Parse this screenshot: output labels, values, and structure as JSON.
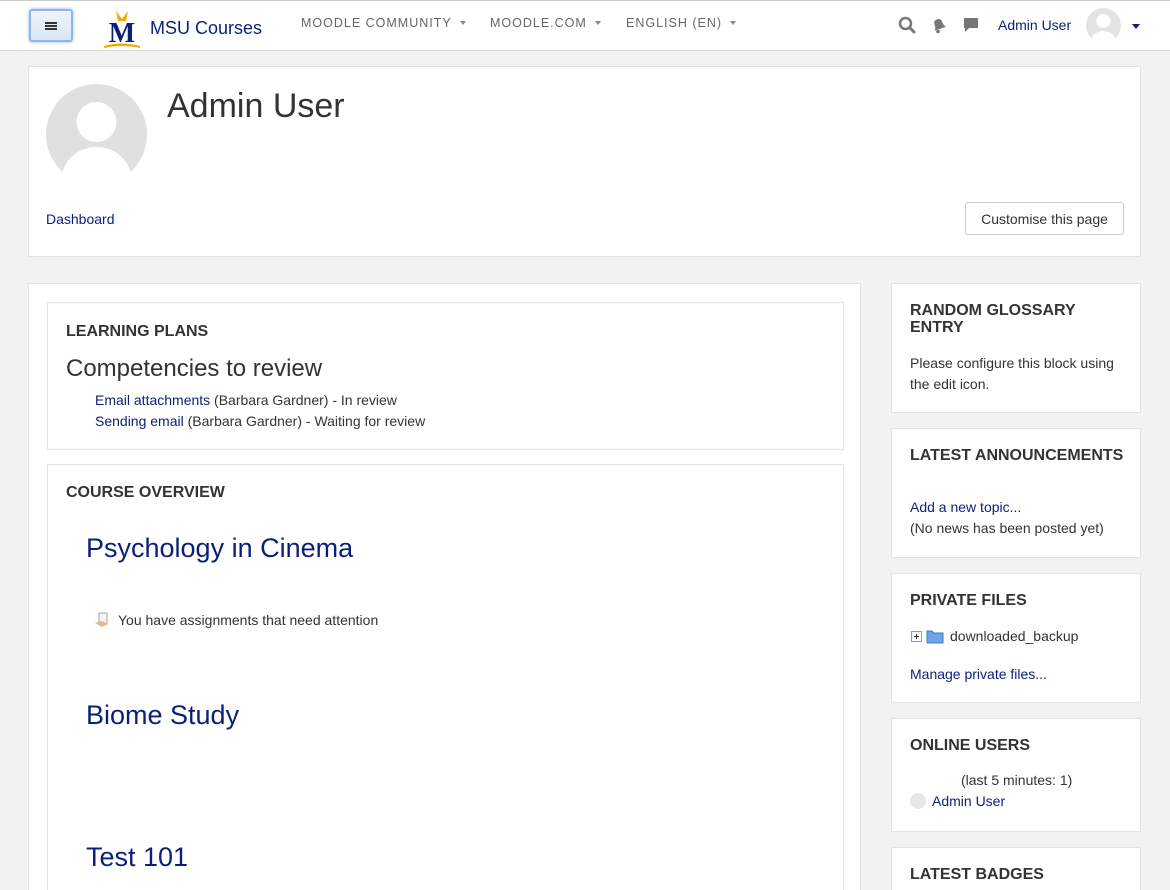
{
  "navbar": {
    "site_name": "MSU Courses",
    "logo_letter": "M",
    "menus": [
      {
        "label": "MOODLE COMMUNITY"
      },
      {
        "label": "MOODLE.COM"
      },
      {
        "label": "ENGLISH (EN)"
      }
    ],
    "user_name": "Admin User",
    "icons": [
      "menu-icon",
      "search-icon",
      "notification-bell-icon",
      "messages-icon",
      "chevron-down-icon"
    ]
  },
  "header": {
    "title": "Admin User",
    "breadcrumb": "Dashboard",
    "customise_label": "Customise this page"
  },
  "learning_plans": {
    "title": "LEARNING PLANS",
    "subtitle": "Competencies to review",
    "items": [
      {
        "link": "Email attachments",
        "rest": " (Barbara Gardner) - In review"
      },
      {
        "link": "Sending email",
        "rest": " (Barbara Gardner) - Waiting for review"
      }
    ]
  },
  "course_overview": {
    "title": "COURSE OVERVIEW",
    "courses": [
      {
        "name": "Psychology in Cinema"
      },
      {
        "name": "Biome Study"
      },
      {
        "name": "Test 101"
      }
    ],
    "assignment_note": "You have assignments that need attention"
  },
  "blocks": {
    "glossary": {
      "title": "RANDOM GLOSSARY ENTRY",
      "text": "Please configure this block using the edit icon."
    },
    "announcements": {
      "title": "LATEST ANNOUNCEMENTS",
      "add_link": "Add a new topic...",
      "note": "(No news has been posted yet)"
    },
    "private_files": {
      "title": "PRIVATE FILES",
      "folder": "downloaded_backup",
      "manage_link": "Manage private files..."
    },
    "online_users": {
      "title": "ONLINE USERS",
      "period": "(last 5 minutes: 1)",
      "user": "Admin User"
    },
    "badges": {
      "title": "LATEST BADGES"
    }
  },
  "colors": {
    "link": "#0b1f7a",
    "logo_blue": "#0b1f7a",
    "logo_gold": "#f2a900"
  }
}
